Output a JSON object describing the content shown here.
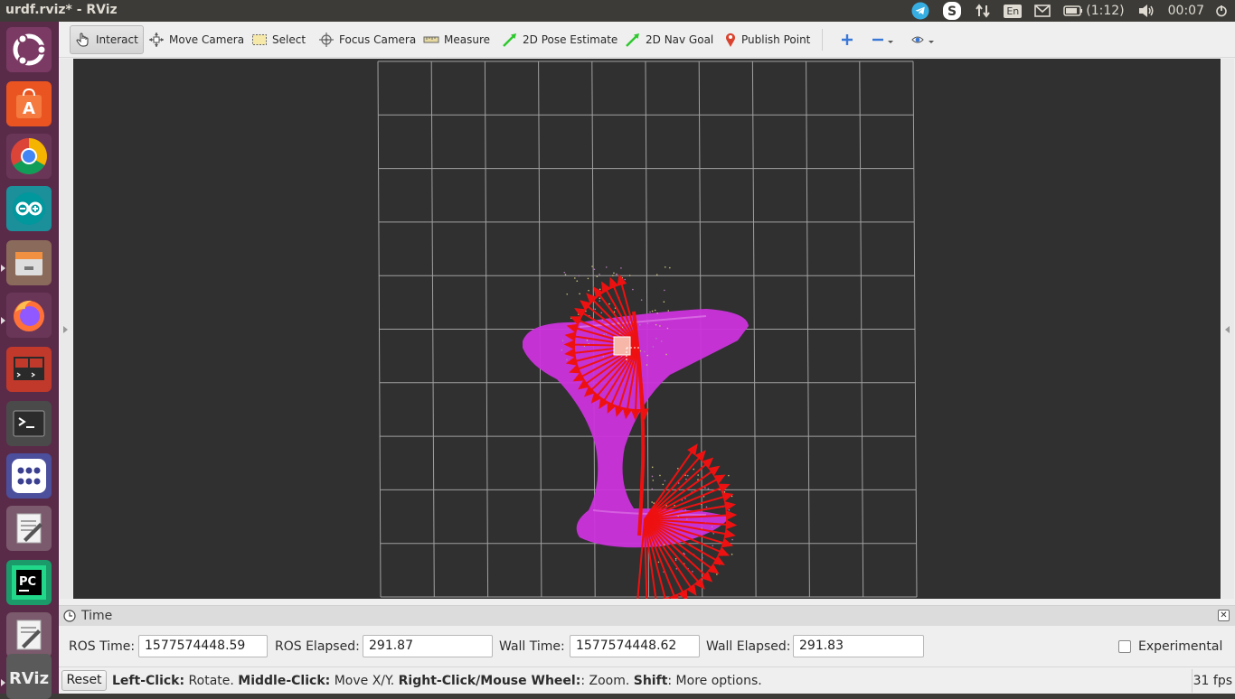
{
  "window": {
    "title": "urdf.rviz* - RViz"
  },
  "indicators": {
    "keyboard": "En",
    "battery": "(1:12)",
    "clock": "00:07"
  },
  "launcher": {
    "items": [
      "ubuntu-dash",
      "software-center",
      "chrome",
      "arduino",
      "file-manager",
      "firefox",
      "system-monitor",
      "terminal",
      "app-grid",
      "text-editor",
      "pycharm",
      "gedit",
      "rviz"
    ]
  },
  "toolbar": {
    "interact": "Interact",
    "move_camera": "Move Camera",
    "select": "Select",
    "focus_camera": "Focus Camera",
    "measure": "Measure",
    "pose_estimate": "2D Pose Estimate",
    "nav_goal": "2D Nav Goal",
    "publish_point": "Publish Point"
  },
  "time_panel": {
    "title": "Time",
    "ros_time_label": "ROS Time:",
    "ros_time": "1577574448.59",
    "ros_elapsed_label": "ROS Elapsed:",
    "ros_elapsed": "291.87",
    "wall_time_label": "Wall Time:",
    "wall_time": "1577574448.62",
    "wall_elapsed_label": "Wall Elapsed:",
    "wall_elapsed": "291.83",
    "experimental_label": "Experimental",
    "experimental_checked": false
  },
  "statusbar": {
    "reset": "Reset",
    "left_click_key": "Left-Click:",
    "left_click_desc": " Rotate. ",
    "middle_click_key": "Middle-Click:",
    "middle_click_desc": " Move X/Y. ",
    "right_click_key": "Right-Click/Mouse Wheel:",
    "right_click_desc": ": Zoom. ",
    "shift_key": "Shift",
    "shift_desc": ": More options.",
    "fps": "31 fps"
  },
  "colors": {
    "launcher_bg": "#5a2a49",
    "viewport_bg": "#303030",
    "pointcloud": "#cc33dd",
    "arrows": "#ee1111"
  }
}
